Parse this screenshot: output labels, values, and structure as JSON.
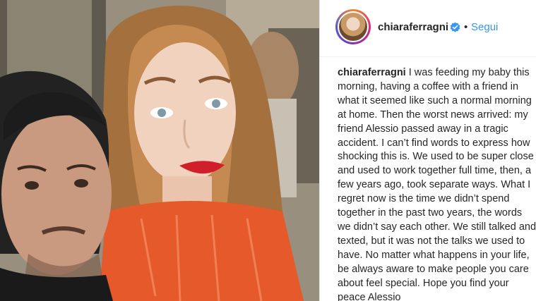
{
  "post": {
    "image_alt": "Selfie of a man and a woman with long wavy hair and red lipstick",
    "author": {
      "username": "chiaraferragni",
      "verified": true,
      "follow_separator": "•",
      "follow_label": "Segui"
    },
    "caption": {
      "username": "chiaraferragni",
      "first_line_rest": " I was feeding my baby this",
      "lines": [
        "morning, having a coffee with a friend in",
        "what it seemed like such a normal morning",
        "at home. Then the worst news arrived: my",
        "friend Alessio passed away in a tragic",
        "accident. I can’t find words to express how",
        "shocking this is. We used to be super close",
        "and used to work together full time, then, a",
        "few years ago, took separate ways. What I",
        "regret now is the time we didn’t spend",
        "together in the past two years, the words",
        "we didn’t say each other. We still talked and",
        "texted, but it was not the talks we used to",
        "have. No matter what happens in your life,",
        "be always aware to make people you care",
        "about feel special. Hope you find your",
        "peace Alessio"
      ]
    },
    "colors": {
      "link": "#3897f0",
      "verified_badge": "#3897f0",
      "text": "#262626"
    }
  }
}
